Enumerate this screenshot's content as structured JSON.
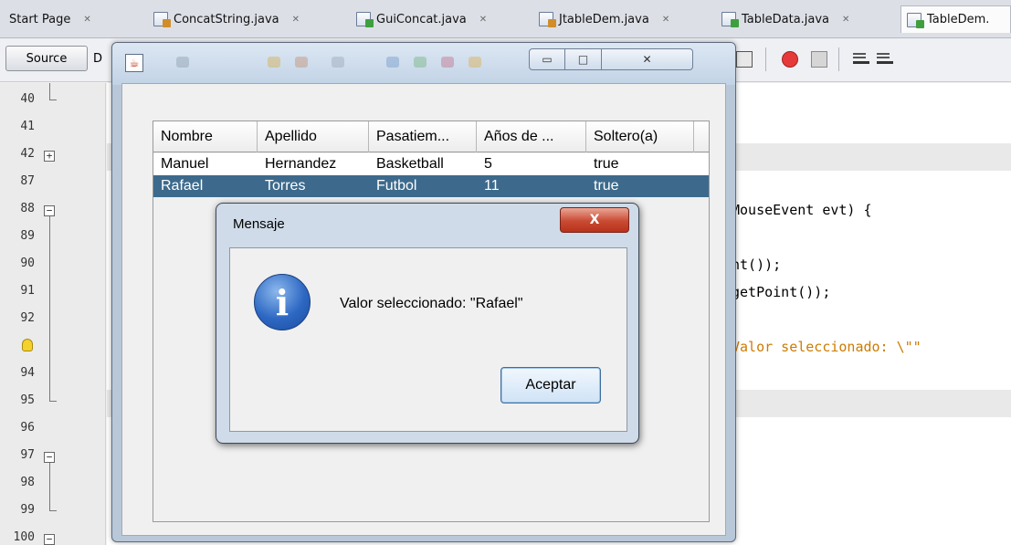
{
  "ide": {
    "tabs": [
      {
        "label": "Start Page",
        "close": "✕"
      },
      {
        "label": "ConcatString.java",
        "close": "✕"
      },
      {
        "label": "GuiConcat.java",
        "close": "✕"
      },
      {
        "label": "JtableDem.java",
        "close": "✕"
      },
      {
        "label": "TableData.java",
        "close": "✕"
      },
      {
        "label": "TableDem."
      }
    ],
    "toolbar": {
      "source_label": "Source",
      "design_label": "D"
    },
    "line_numbers": [
      "40",
      "41",
      "42",
      "87",
      "88",
      "89",
      "90",
      "91",
      "92",
      "94",
      "95",
      "96",
      "97",
      "98",
      "99",
      "100"
    ],
    "fold_plus": "+",
    "fold_minus": "−",
    "code_lines": [
      {
        "text": "MouseEvent evt) {",
        "kind": "normal"
      },
      {
        "text": "nt());",
        "kind": "normal"
      },
      {
        "text": "getPoint());",
        "kind": "normal"
      },
      {
        "text": "Valor seleccionado: \\\"\"",
        "kind": "string"
      }
    ]
  },
  "frame": {
    "icon": "java-icon",
    "buttons": {
      "minimize": "▭",
      "maximize": "□",
      "close": "✕"
    },
    "table": {
      "columns": [
        "Nombre",
        "Apellido",
        "Pasatiem...",
        "Años de ...",
        "Soltero(a)"
      ],
      "rows": [
        [
          "Manuel",
          "Hernandez",
          "Basketball",
          "5",
          "true"
        ],
        [
          "Rafael",
          "Torres",
          "Futbol",
          "11",
          "true"
        ]
      ],
      "selected_row": 1
    }
  },
  "dialog": {
    "title": "Mensaje",
    "close_glyph": "X",
    "icon_glyph": "i",
    "message": "Valor seleccionado: \"Rafael\"",
    "ok_label": "Aceptar"
  }
}
